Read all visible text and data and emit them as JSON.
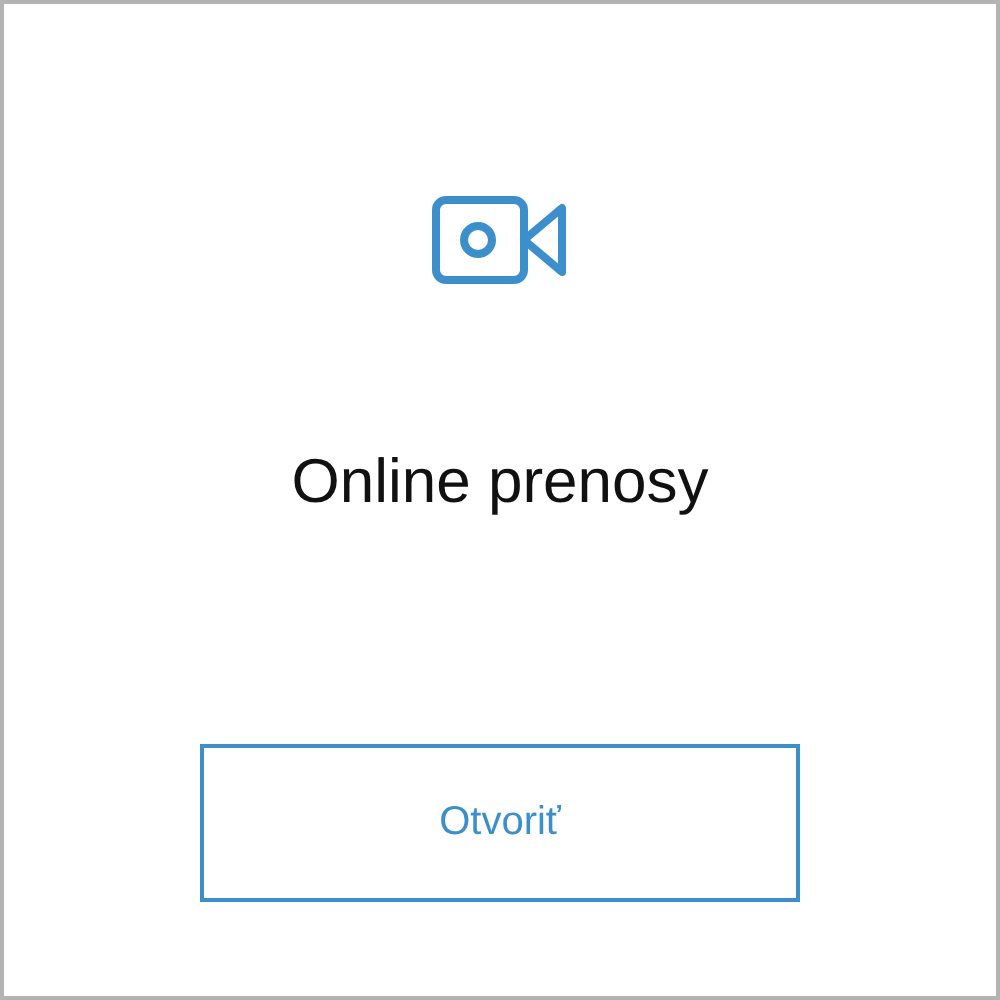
{
  "card": {
    "title": "Online prenosy",
    "button": "Otvoriť"
  }
}
